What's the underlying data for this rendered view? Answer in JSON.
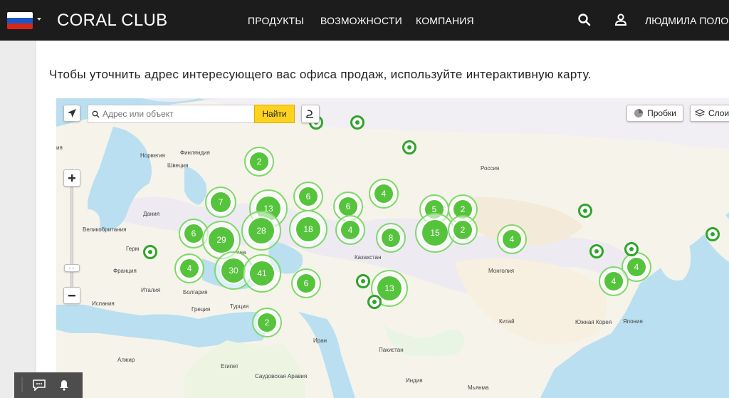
{
  "header": {
    "brand": "CORAL CLUB",
    "nav": [
      "ПРОДУКТЫ",
      "ВОЗМОЖНОСТИ",
      "КОМПАНИЯ"
    ],
    "username": "ЛЮДМИЛА ПОЛО",
    "flag_colors": [
      "#ffffff",
      "#1c57c4",
      "#d62718"
    ]
  },
  "intro_text": "Чтобы уточнить адрес интересующего вас офиса продаж, используйте интерактивную карту.",
  "map": {
    "search_placeholder": "Адрес или объект",
    "find_label": "Найти",
    "traffic_label": "Пробки",
    "layers_label": "Слои",
    "geo_labels": [
      "Норвегия",
      "Финляндия",
      "Швеция",
      "Россия",
      "Дания",
      "Великобритания",
      "Герм",
      "Франция",
      "Италия",
      "Болгария",
      "Испания",
      "Греция",
      "Турция",
      "Казахстан",
      "Монголия",
      "Китай",
      "Южная Корея",
      "Япония",
      "Иран",
      "Пакистан",
      "Алжир",
      "Египет",
      "Саудовская Аравия",
      "Индия",
      "Мьянма",
      "ия",
      "ина"
    ],
    "clusters": [
      "2",
      "7",
      "13",
      "6",
      "6",
      "4",
      "5",
      "2",
      "6",
      "29",
      "28",
      "18",
      "4",
      "8",
      "15",
      "2",
      "4",
      "4",
      "30",
      "41",
      "6",
      "13",
      "4",
      "4",
      "2"
    ]
  },
  "colors": {
    "accent_green": "#56c33c",
    "pin_green": "#2fa52a",
    "find_yellow": "#ffd21f",
    "header_bg": "#1c1c1c"
  }
}
